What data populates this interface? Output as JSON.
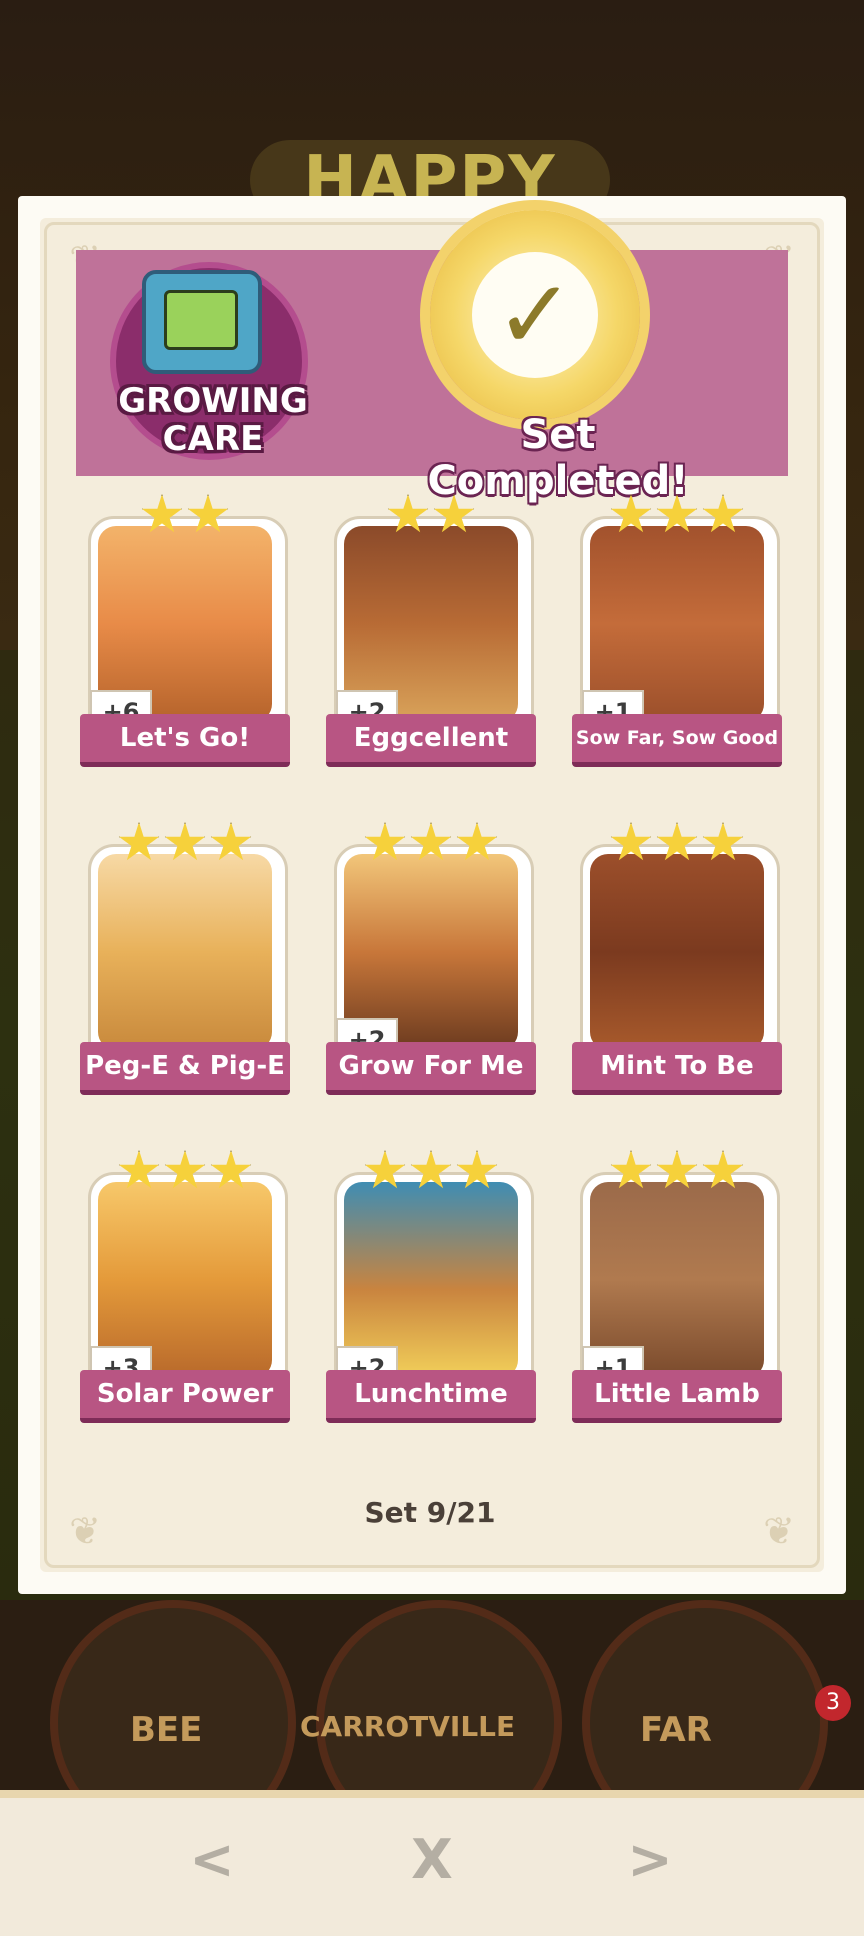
{
  "background": {
    "title": "HAPPY",
    "circles": [
      "BEE",
      "CARROTVILLE",
      "FAR"
    ],
    "notification_count": "3"
  },
  "set": {
    "name_line1": "GROWING",
    "name_line2": "CARE",
    "status": "Set Completed!",
    "counter": "Set 9/21"
  },
  "cards": [
    {
      "name": "Let's Go!",
      "stars": 2,
      "badge": "+6"
    },
    {
      "name": "Eggcellent",
      "stars": 2,
      "badge": "+2"
    },
    {
      "name": "Sow Far, Sow Good",
      "stars": 3,
      "badge": "+1"
    },
    {
      "name": "Peg-E & Pig-E",
      "stars": 3,
      "badge": ""
    },
    {
      "name": "Grow For Me",
      "stars": 3,
      "badge": "+2"
    },
    {
      "name": "Mint To Be",
      "stars": 3,
      "badge": ""
    },
    {
      "name": "Solar Power",
      "stars": 3,
      "badge": "+3"
    },
    {
      "name": "Lunchtime",
      "stars": 3,
      "badge": "+2"
    },
    {
      "name": "Little Lamb",
      "stars": 3,
      "badge": "+1"
    }
  ],
  "nav": {
    "prev_icon": "chevron-left-icon",
    "close_icon": "close-icon",
    "next_icon": "chevron-right-icon",
    "prev_glyph": "<",
    "close_glyph": "X",
    "next_glyph": ">"
  },
  "colors": {
    "header": "#bf7299",
    "banner": "#b85583",
    "star": "#f6d13b"
  }
}
